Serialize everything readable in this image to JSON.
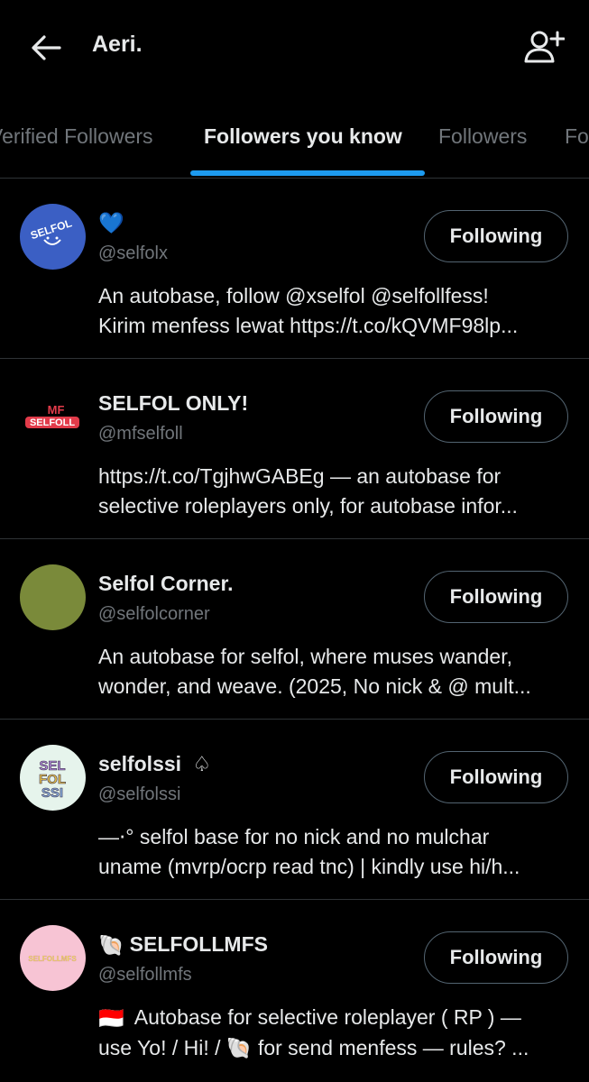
{
  "header": {
    "title": "Aeri.",
    "back_icon": "arrow-left-icon",
    "add_icon": "person-add-icon"
  },
  "tabs": [
    {
      "label": "Verified Followers",
      "active": false
    },
    {
      "label": "Followers you know",
      "active": true
    },
    {
      "label": "Followers",
      "active": false
    },
    {
      "label": "Following",
      "active": false
    }
  ],
  "colors": {
    "accent": "#1d9bf0",
    "background": "#000000",
    "text_primary": "#e7e9ea",
    "text_secondary": "#71767b",
    "divider": "#2f3336"
  },
  "users": [
    {
      "name": "💙",
      "handle": "@selfolx",
      "bio_line1": "An autobase, follow @xselfol @selfollfess!",
      "bio_line2": "Kirim menfess lewat https://t.co/kQVMF98lp...",
      "button": "Following",
      "avatar_text": "SELFOL",
      "avatar_color": "#3b5fc4"
    },
    {
      "name": "SELFOL ONLY!",
      "handle": "@mfselfoll",
      "bio_line1": "https://t.co/TgjhwGABEg — an autobase for",
      "bio_line2": "selective roleplayers only, for autobase infor...",
      "button": "Following",
      "avatar_text_top": "MF",
      "avatar_text_bottom": "SELFOLL",
      "avatar_color": "#000000"
    },
    {
      "name": "Selfol Corner.",
      "handle": "@selfolcorner",
      "bio_line1": "An autobase for selfol, where muses wander,",
      "bio_line2": "wonder, and weave. (2025, No nick & @ mult...",
      "button": "Following",
      "avatar_color": "#7a8a3a"
    },
    {
      "name": "selfolssi",
      "name_badge": "♤",
      "handle": "@selfolssi",
      "bio_line1": "—⋅° selfol base for no nick and no mulchar",
      "bio_line2": "uname (mvrp/ocrp read tnc) | kindly use hi/h...",
      "button": "Following",
      "avatar_text_lines": [
        "SEL",
        "FOL",
        "SSI"
      ],
      "avatar_color": "#e6f4ec"
    },
    {
      "name": "SELFOLLMFS",
      "name_prefix": "🐚",
      "handle": "@selfollmfs",
      "bio_prefix": "🇮🇩",
      "bio_line1": "Autobase for selective roleplayer ( RP ) —",
      "bio_line2_a": "use Yo! / Hi! /",
      "bio_line2_emoji": "🐚",
      "bio_line2_b": "for send menfess — rules? ...",
      "button": "Following",
      "avatar_text": "SELFOLLMFS",
      "avatar_color": "#f7c4d4"
    }
  ]
}
